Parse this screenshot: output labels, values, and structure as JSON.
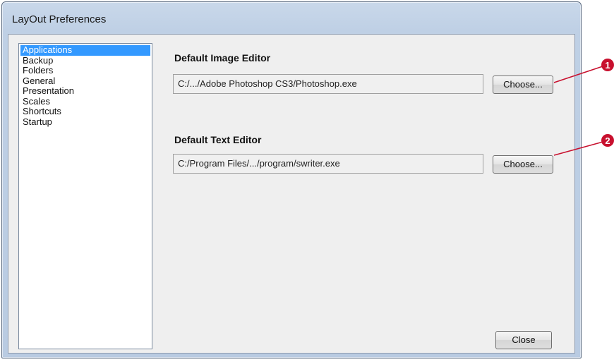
{
  "window": {
    "title": "LayOut Preferences"
  },
  "sidebar": {
    "items": [
      {
        "label": "Applications",
        "selected": true
      },
      {
        "label": "Backup",
        "selected": false
      },
      {
        "label": "Folders",
        "selected": false
      },
      {
        "label": "General",
        "selected": false
      },
      {
        "label": "Presentation",
        "selected": false
      },
      {
        "label": "Scales",
        "selected": false
      },
      {
        "label": "Shortcuts",
        "selected": false
      },
      {
        "label": "Startup",
        "selected": false
      }
    ]
  },
  "main": {
    "image_editor": {
      "label": "Default Image Editor",
      "path": "C:/.../Adobe Photoshop CS3/Photoshop.exe",
      "button": "Choose..."
    },
    "text_editor": {
      "label": "Default Text Editor",
      "path": "C:/Program Files/.../program/swriter.exe",
      "button": "Choose..."
    }
  },
  "footer": {
    "close_label": "Close"
  },
  "callouts": {
    "color": "#c8102e",
    "items": [
      {
        "number": "1"
      },
      {
        "number": "2"
      }
    ]
  }
}
